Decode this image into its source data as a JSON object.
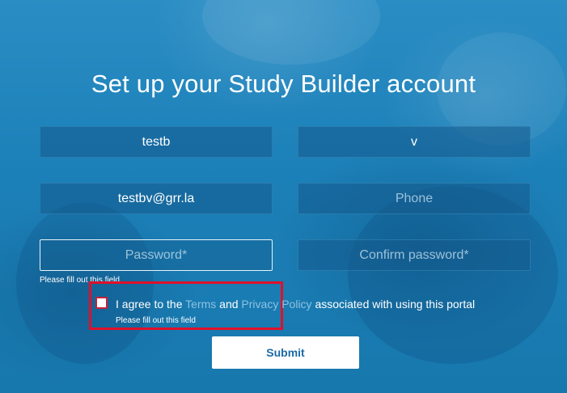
{
  "page": {
    "title": "Set up your Study Builder account"
  },
  "form": {
    "first_name": {
      "value": "testb",
      "placeholder": ""
    },
    "last_name": {
      "value": "v",
      "placeholder": ""
    },
    "email": {
      "value": "testbv@grr.la",
      "placeholder": ""
    },
    "phone": {
      "value": "",
      "placeholder": "Phone"
    },
    "password": {
      "value": "",
      "placeholder": "Password*",
      "validation": "Please fill out this field"
    },
    "confirm_password": {
      "value": "",
      "placeholder": "Confirm password*"
    },
    "terms": {
      "checked": false,
      "prefix": "I agree to the",
      "terms_link": "Terms",
      "and": "and",
      "privacy_link": "Privacy Policy",
      "suffix": "associated with using this portal",
      "validation": "Please fill out this field"
    },
    "submit_label": "Submit"
  },
  "colors": {
    "background": "#1b7fb6",
    "link": "#8ec2e3",
    "highlight_box": "#e0102a",
    "submit_text": "#1b6aa6"
  }
}
